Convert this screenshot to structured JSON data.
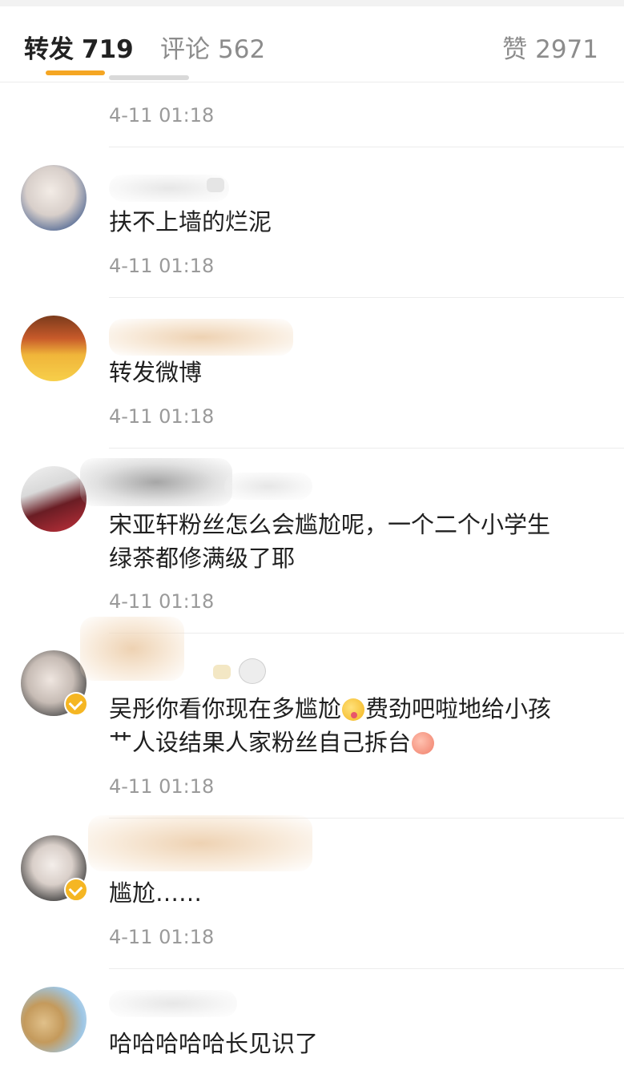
{
  "tabs": {
    "repost": {
      "label": "转发",
      "count": "719"
    },
    "comment": {
      "label": "评论",
      "count": "562"
    },
    "like": {
      "label": "赞",
      "count": "2971"
    }
  },
  "items": [
    {
      "text": "",
      "time": "4-11 01:18"
    },
    {
      "text": "扶不上墙的烂泥",
      "time": "4-11 01:18"
    },
    {
      "text": "转发微博",
      "time": "4-11 01:18"
    },
    {
      "text_line1": "宋亚轩粉丝怎么会尴尬呢，一个二个小学生",
      "text_line2": "绿茶都修满级了耶",
      "time": "4-11 01:18"
    },
    {
      "text_part1": "吴彤你看你现在多尴尬",
      "text_part2": "费劲吧啦地给小孩",
      "text_line2": "艹人设结果人家粉丝自己拆台",
      "time": "4-11 01:18",
      "emoji1": "tongue-emoji",
      "emoji2": "pig-emoji"
    },
    {
      "text": "尴尬……",
      "time": "4-11 01:18"
    },
    {
      "text": "哈哈哈哈哈长见识了"
    }
  ],
  "colors": {
    "accent": "#f5a623",
    "time": "#9a9a9a",
    "verified": "#f5b623"
  }
}
